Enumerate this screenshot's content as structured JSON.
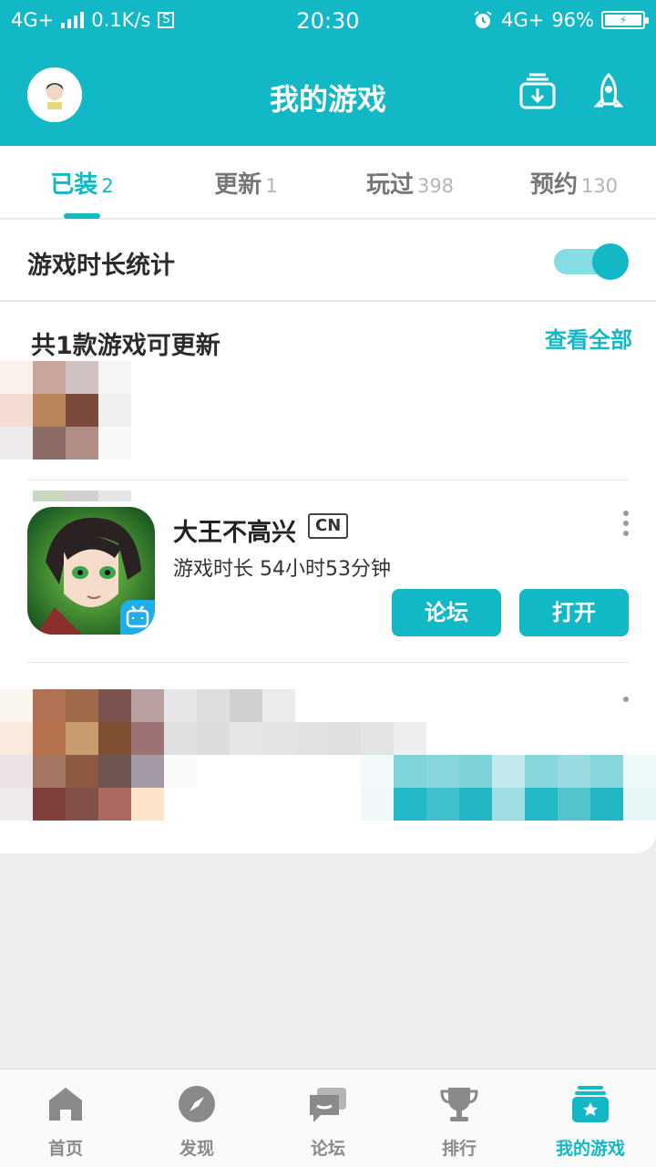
{
  "status_bar": {
    "network": "4G+",
    "speed": "0.1K/s",
    "sim_badge": "S",
    "time": "20:30",
    "network_right": "4G+",
    "battery": "96%",
    "icons": [
      "signal-icon",
      "alarm-icon",
      "battery-charging-icon"
    ]
  },
  "header": {
    "title": "我的游戏",
    "icons": [
      "avatar",
      "download-manager-icon",
      "rocket-icon"
    ]
  },
  "tabs": [
    {
      "label": "已装",
      "count": "2",
      "active": true
    },
    {
      "label": "更新",
      "count": "1",
      "active": false
    },
    {
      "label": "玩过",
      "count": "398",
      "active": false
    },
    {
      "label": "预约",
      "count": "130",
      "active": false
    }
  ],
  "playtime_stats": {
    "label": "游戏时长统计",
    "enabled": true
  },
  "updates": {
    "title": "共1款游戏可更新",
    "view_all": "查看全部"
  },
  "game": {
    "name": "大王不高兴",
    "region_badge": "CN",
    "playtime": "游戏时长 54小时53分钟",
    "forum_button": "论坛",
    "open_button": "打开",
    "icons": [
      "game-icon",
      "bilibili-icon",
      "more-vertical-icon"
    ]
  },
  "bottom_nav": [
    {
      "label": "首页",
      "icon": "home-icon",
      "active": false
    },
    {
      "label": "发现",
      "icon": "compass-icon",
      "active": false
    },
    {
      "label": "论坛",
      "icon": "chat-icon",
      "active": false
    },
    {
      "label": "排行",
      "icon": "trophy-icon",
      "active": false
    },
    {
      "label": "我的游戏",
      "icon": "my-games-icon",
      "active": true
    }
  ],
  "colors": {
    "accent": "#12b8c6",
    "inactive": "#8a8a8a",
    "background": "#ededed"
  }
}
